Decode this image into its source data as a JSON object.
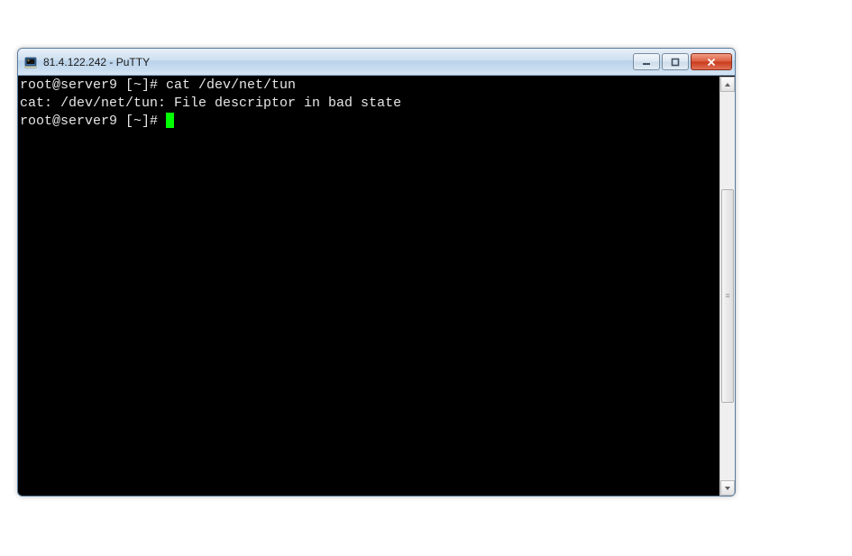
{
  "window": {
    "title": "81.4.122.242 - PuTTY"
  },
  "terminal": {
    "lines": [
      "root@server9 [~]# cat /dev/net/tun",
      "cat: /dev/net/tun: File descriptor in bad state",
      "root@server9 [~]# "
    ]
  }
}
